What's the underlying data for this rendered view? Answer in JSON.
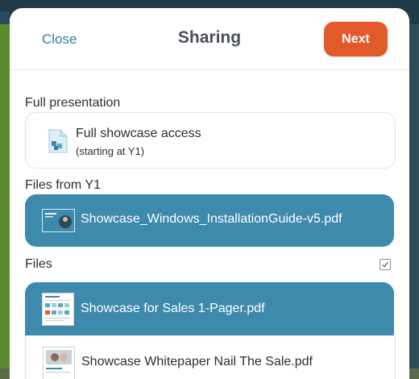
{
  "header": {
    "close_label": "Close",
    "title": "Sharing",
    "next_label": "Next"
  },
  "sections": {
    "full_presentation": {
      "label": "Full presentation",
      "item_title": "Full showcase access",
      "item_subtitle": "(starting at Y1)"
    },
    "files_from_y1": {
      "label": "Files from Y1",
      "items": [
        {
          "name": "Showcase_Windows_InstallationGuide-v5.pdf",
          "selected": true
        }
      ]
    },
    "files": {
      "label": "Files",
      "items": [
        {
          "name": "Showcase for Sales 1-Pager.pdf",
          "selected": true
        },
        {
          "name": "Showcase Whitepaper Nail The Sale.pdf",
          "selected": false
        }
      ]
    }
  },
  "colors": {
    "accent_orange": "#e35a2a",
    "selected_blue": "#3e8aad",
    "link_blue": "#2f7fa8"
  }
}
